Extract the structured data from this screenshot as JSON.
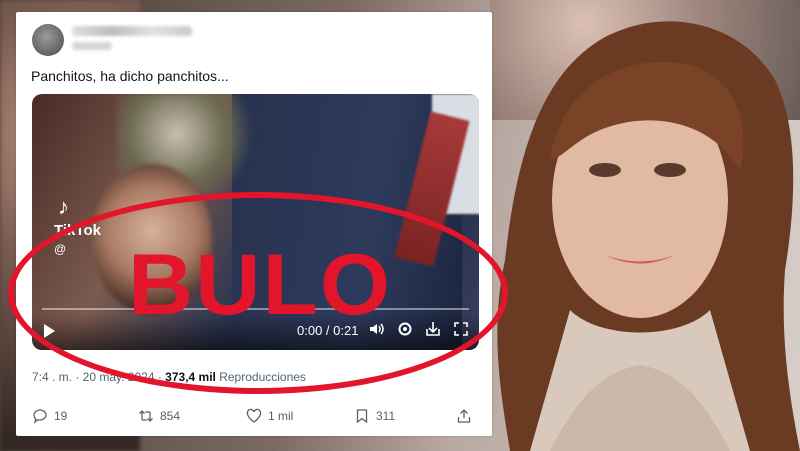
{
  "tweet": {
    "text": "Panchitos, ha dicho panchitos...",
    "video": {
      "watermark": "TikTok",
      "watermark_handle": "@",
      "time": "0:00 / 0:21",
      "progress": 0
    },
    "meta": {
      "time_date": "7:4 . m. · 20 may. 2024 · ",
      "views_count": "373,4 mil",
      "views_label": " Reproducciones"
    },
    "actions": {
      "replies": "19",
      "reposts": "854",
      "likes": "1 mil",
      "bookmarks": "311"
    }
  },
  "stamp": {
    "label": "BULO",
    "color": "#e3152b"
  }
}
